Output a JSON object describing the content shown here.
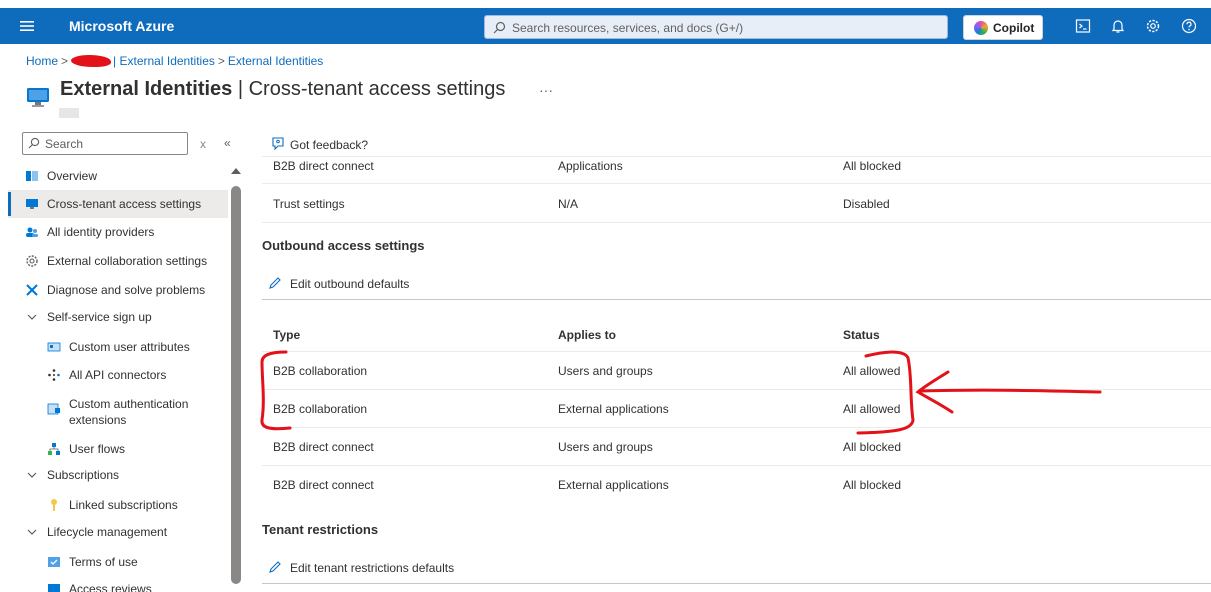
{
  "topbar": {
    "brand": "Microsoft Azure",
    "search_placeholder": "Search resources, services, and docs (G+/)",
    "copilot_label": "Copilot",
    "icons": [
      "cloud-shell-icon",
      "notifications-icon",
      "settings-icon",
      "help-icon"
    ],
    "color": "#0f6cbd"
  },
  "breadcrumb": {
    "home": "Home",
    "tenant_sep": "|",
    "items": [
      "External Identities",
      "External Identities"
    ]
  },
  "page": {
    "title_bold": "External Identities",
    "title_rest": " | Cross-tenant access settings",
    "more": "···"
  },
  "nav": {
    "search_placeholder": "Search",
    "clear": "x",
    "collapse": "«",
    "items": [
      {
        "label": "Overview",
        "icon": "overview-icon"
      },
      {
        "label": "Cross-tenant access settings",
        "icon": "monitor-icon",
        "active": true
      },
      {
        "label": "All identity providers",
        "icon": "users-icon"
      },
      {
        "label": "External collaboration settings",
        "icon": "gear-icon"
      },
      {
        "label": "Diagnose and solve problems",
        "icon": "wrench-icon"
      },
      {
        "label": "Self-service sign up",
        "icon": "chevron-down-icon"
      },
      {
        "label": "Custom user attributes",
        "icon": "attributes-icon"
      },
      {
        "label": "All API connectors",
        "icon": "api-connectors-icon"
      },
      {
        "label": "Custom authentication",
        "label2": "extensions",
        "icon": "extension-icon"
      },
      {
        "label": "User flows",
        "icon": "user-flows-icon"
      },
      {
        "label": "Subscriptions",
        "icon": "chevron-down-icon"
      },
      {
        "label": "Linked subscriptions",
        "icon": "key-icon"
      },
      {
        "label": "Lifecycle management",
        "icon": "chevron-down-icon"
      },
      {
        "label": "Terms of use",
        "icon": "terms-icon"
      },
      {
        "label": "Access reviews",
        "icon": "access-reviews-icon"
      }
    ]
  },
  "main": {
    "feedback": "Got feedback?",
    "inbound_rows": [
      {
        "type": "B2B direct connect",
        "applies": "Applications",
        "status": "All blocked"
      },
      {
        "type": "Trust settings",
        "applies": "N/A",
        "status": "Disabled"
      }
    ],
    "outbound": {
      "title": "Outbound access settings",
      "edit": "Edit outbound defaults",
      "headers": {
        "type": "Type",
        "applies": "Applies to",
        "status": "Status"
      },
      "rows": [
        {
          "type": "B2B collaboration",
          "applies": "Users and groups",
          "status": "All allowed"
        },
        {
          "type": "B2B collaboration",
          "applies": "External applications",
          "status": "All allowed"
        },
        {
          "type": "B2B direct connect",
          "applies": "Users and groups",
          "status": "All blocked"
        },
        {
          "type": "B2B direct connect",
          "applies": "External applications",
          "status": "All blocked"
        }
      ]
    },
    "tenant": {
      "title": "Tenant restrictions",
      "edit": "Edit tenant restrictions defaults"
    }
  },
  "annotation_color": "#e3121a"
}
